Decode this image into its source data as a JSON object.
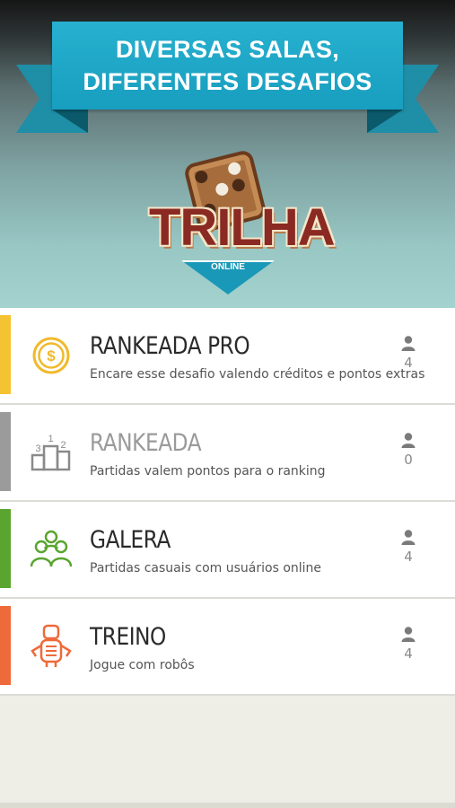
{
  "banner": {
    "line1": "DIVERSAS SALAS,",
    "line2": "DIFERENTES DESAFIOS"
  },
  "logo": {
    "title": "TRILHA",
    "subtitle": "ONLINE"
  },
  "rooms": [
    {
      "title": "RANKEADA PRO",
      "description": "Encare esse desafio valendo créditos e pontos extras",
      "users": "4",
      "icon": "coin-icon",
      "accent": "#f5c332"
    },
    {
      "title": "RANKEADA",
      "description": "Partidas valem pontos para o ranking",
      "users": "0",
      "icon": "podium-icon",
      "accent": "#9b9b9b"
    },
    {
      "title": "GALERA",
      "description": "Partidas casuais com usuários online",
      "users": "4",
      "icon": "people-group-icon",
      "accent": "#5aa530"
    },
    {
      "title": "TREINO",
      "description": "Jogue com robôs",
      "users": "4",
      "icon": "robot-icon",
      "accent": "#ee6a3a"
    }
  ],
  "colors": {
    "ribbon": "#1fa6c6",
    "logo_red": "#8a2a22",
    "background": "#eeede6"
  }
}
